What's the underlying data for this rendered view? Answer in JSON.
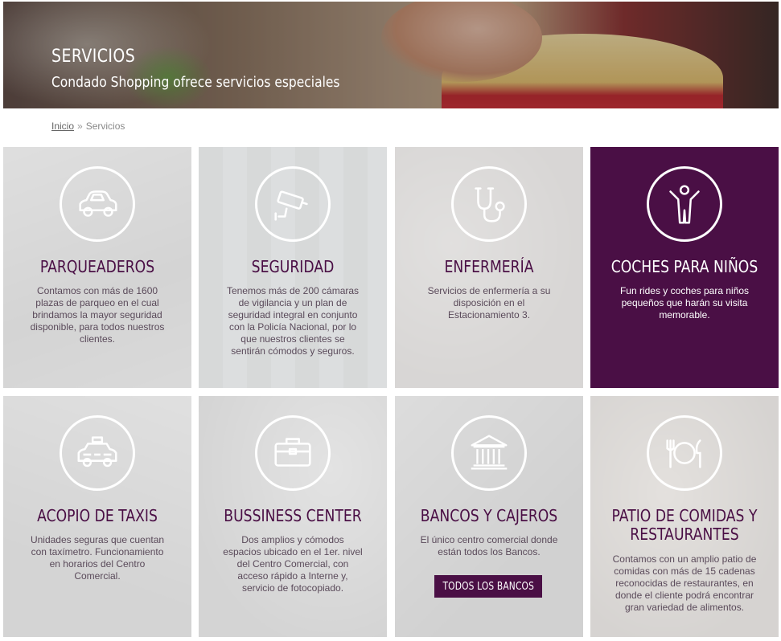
{
  "hero": {
    "title": "SERVICIOS",
    "subtitle": "Condado Shopping ofrece servicios especiales"
  },
  "breadcrumb": {
    "home": "Inicio",
    "separator": "»",
    "current": "Servicios"
  },
  "colors": {
    "accent": "#4a0f45",
    "card_bg": "#e3e3e3",
    "text": "#5a4a5a"
  },
  "services": [
    {
      "icon": "car-icon",
      "title": "PARQUEADEROS",
      "description": "Contamos con más de 1600 plazas de parqueo en el cual brindamos la mayor seguridad disponible, para todos nuestros clientes."
    },
    {
      "icon": "cctv-icon",
      "title": "SEGURIDAD",
      "description": "Tenemos más de 200 cámaras de vigilancia y un plan de seguridad integral en conjunto con la Policía Nacional, por lo que nuestros clientes se sentirán cómodos y seguros."
    },
    {
      "icon": "stethoscope-icon",
      "title": "ENFERMERÍA",
      "description": "Servicios de enfermería a su disposición en el Estacionamiento 3."
    },
    {
      "icon": "child-icon",
      "title": "COCHES PARA NIÑOS",
      "description": "Fun rides y coches para niños pequeños que harán su visita memorable."
    },
    {
      "icon": "taxi-icon",
      "title": "ACOPIO DE TAXIS",
      "description": "Unidades seguras que cuentan con taxímetro. Funcionamiento en horarios del Centro Comercial."
    },
    {
      "icon": "briefcase-icon",
      "title": "BUSSINESS CENTER",
      "description": "Dos amplios y cómodos espacios ubicado en el 1er. nivel del Centro Comercial, con acceso rápido a Interne y, servicio de fotocopiado."
    },
    {
      "icon": "bank-icon",
      "title": "BANCOS Y CAJEROS",
      "description": "El único centro comercial donde están todos los Bancos.",
      "button": "TODOS LOS BANCOS"
    },
    {
      "icon": "plate-cutlery-icon",
      "title": "PATIO DE COMIDAS Y RESTAURANTES",
      "description": "Contamos con un amplio patio de comidas con más de 15 cadenas reconocidas de restaurantes, en donde el cliente podrá encontrar gran variedad de alimentos."
    }
  ]
}
